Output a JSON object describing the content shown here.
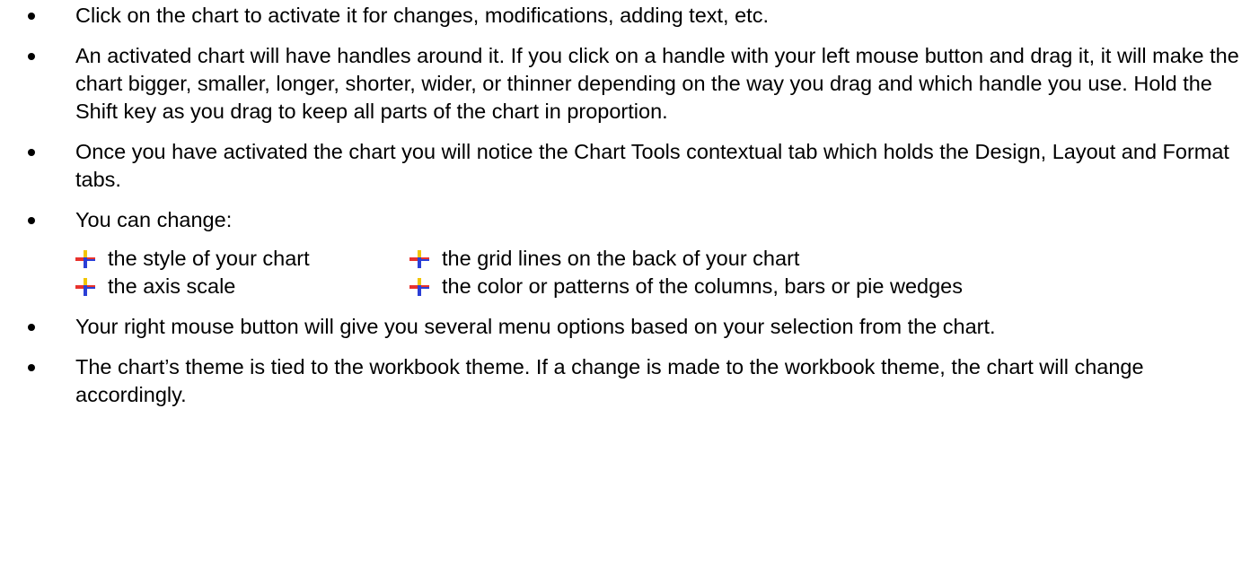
{
  "bullets": [
    "Click on the chart to activate it for changes, modifications, adding text, etc.",
    "An activated chart will have handles around it.  If you click on a handle with your left mouse button and drag it, it will make the chart bigger, smaller, longer, shorter, wider, or thinner depending on the way you drag and which handle you use.  Hold the Shift key as you drag to keep all parts of the chart in proportion.",
    "Once you have activated the chart you will notice the Chart Tools contextual tab which holds the Design, Layout and Format tabs.",
    "You can change:",
    "Your right mouse button will give you several menu options based on your selection from the chart.",
    "The chart’s theme is tied to the workbook theme.  If a change is made to the workbook theme, the chart will change accordingly."
  ],
  "change_options": [
    "the style of your chart",
    "the grid lines on the back of your chart",
    "the axis scale",
    "the color or patterns of the columns, bars or pie wedges"
  ],
  "colors": {
    "text": "#000000",
    "icon_red": "#e8322d",
    "icon_blue": "#2b3fd6",
    "icon_yellow": "#f2c500"
  },
  "icons": {
    "bullet": "round-bullet",
    "sub_bullet": "plus-sparkle-icon"
  }
}
